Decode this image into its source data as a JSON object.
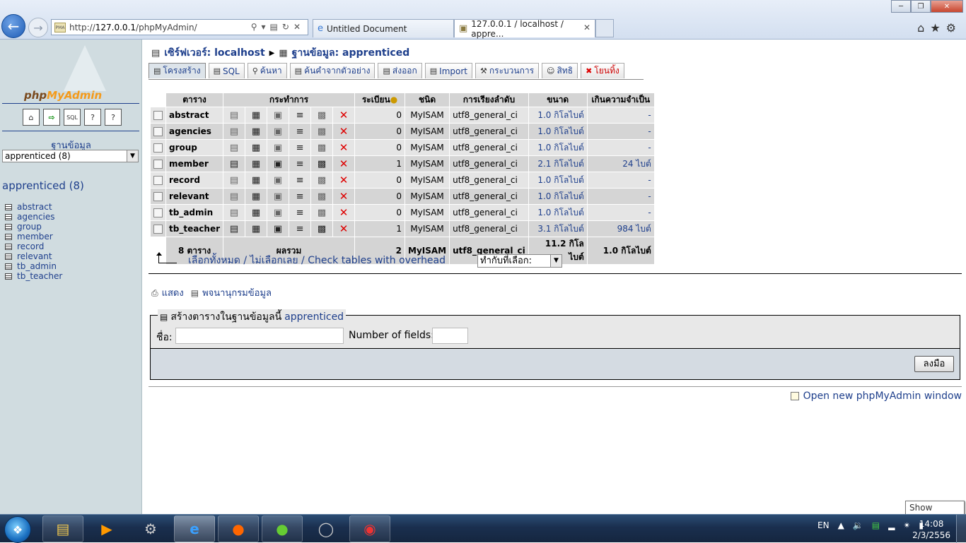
{
  "browser": {
    "url_prefix": "http://",
    "url_host": "127.0.0.1",
    "url_path": "/phpMyAdmin/",
    "tabs": [
      {
        "title": "Untitled Document"
      },
      {
        "title": "127.0.0.1 / localhost / appre..."
      }
    ]
  },
  "sidebar": {
    "logo_php": "php",
    "logo_admin": "MyAdmin",
    "db_label": "ฐานข้อมูล",
    "db_select": "apprenticed (8)",
    "db_heading": "apprenticed (8)",
    "tables": [
      "abstract",
      "agencies",
      "group",
      "member",
      "record",
      "relevant",
      "tb_admin",
      "tb_teacher"
    ]
  },
  "main": {
    "server_label": "เซิร์ฟเวอร์: localhost",
    "db_crumb": "ฐานข้อมูล: apprenticed",
    "tabs": [
      {
        "label": "โครงสร้าง",
        "icon": "structure-icon"
      },
      {
        "label": "SQL",
        "icon": "sql-icon"
      },
      {
        "label": "ค้นหา",
        "icon": "search-icon"
      },
      {
        "label": "ค้นคำจากตัวอย่าง",
        "icon": "query-icon"
      },
      {
        "label": "ส่งออก",
        "icon": "export-icon"
      },
      {
        "label": "Import",
        "icon": "import-icon"
      },
      {
        "label": "กระบวนการ",
        "icon": "operations-icon"
      },
      {
        "label": "สิทธิ",
        "icon": "privileges-icon"
      },
      {
        "label": "โยนทิ้ง",
        "icon": "drop-icon"
      }
    ],
    "table_headers": {
      "table": "ตาราง",
      "action": "กระทำการ",
      "records": "ระเบียน",
      "type": "ชนิด",
      "collation": "การเรียงลำดับ",
      "size": "ขนาด",
      "overhead": "เกินความจำเป็น"
    },
    "rows": [
      {
        "name": "abstract",
        "records": "0",
        "type": "MyISAM",
        "collation": "utf8_general_ci",
        "size": "1.0 กิโลไบต์",
        "overhead": "-"
      },
      {
        "name": "agencies",
        "records": "0",
        "type": "MyISAM",
        "collation": "utf8_general_ci",
        "size": "1.0 กิโลไบต์",
        "overhead": "-"
      },
      {
        "name": "group",
        "records": "0",
        "type": "MyISAM",
        "collation": "utf8_general_ci",
        "size": "1.0 กิโลไบต์",
        "overhead": "-"
      },
      {
        "name": "member",
        "records": "1",
        "type": "MyISAM",
        "collation": "utf8_general_ci",
        "size": "2.1 กิโลไบต์",
        "overhead": "24 ไบต์"
      },
      {
        "name": "record",
        "records": "0",
        "type": "MyISAM",
        "collation": "utf8_general_ci",
        "size": "1.0 กิโลไบต์",
        "overhead": "-"
      },
      {
        "name": "relevant",
        "records": "0",
        "type": "MyISAM",
        "collation": "utf8_general_ci",
        "size": "1.0 กิโลไบต์",
        "overhead": "-"
      },
      {
        "name": "tb_admin",
        "records": "0",
        "type": "MyISAM",
        "collation": "utf8_general_ci",
        "size": "1.0 กิโลไบต์",
        "overhead": "-"
      },
      {
        "name": "tb_teacher",
        "records": "1",
        "type": "MyISAM",
        "collation": "utf8_general_ci",
        "size": "3.1 กิโลไบต์",
        "overhead": "984 ไบต์"
      }
    ],
    "footer": {
      "count": "8 ตาราง",
      "sum_label": "ผลรวม",
      "records": "2",
      "type": "MyISAM",
      "collation": "utf8_general_ci",
      "size": "11.2 กิโลไบต์",
      "overhead": "1.0 กิโลไบต์"
    },
    "check_all": "เลือกทั้งหมด",
    "uncheck_all": "ไม่เลือกเลย",
    "check_overhead": "Check tables with overhead",
    "sep": " / ",
    "with_selected": "ทำกับที่เลือก:",
    "print_link": "แสดง",
    "dictionary_link": "พจนานุกรมข้อมูล",
    "create_legend": "สร้างตารางในฐานข้อมูลนี้",
    "create_db": "apprenticed",
    "name_label": "ชื่อ:",
    "fields_label": "Number of fields:",
    "go_label": "ลงมือ",
    "open_new": "Open new phpMyAdmin window"
  },
  "taskbar": {
    "lang": "EN",
    "time": "14:08",
    "date": "2/3/2556",
    "show_desktop": "Show desktop"
  }
}
